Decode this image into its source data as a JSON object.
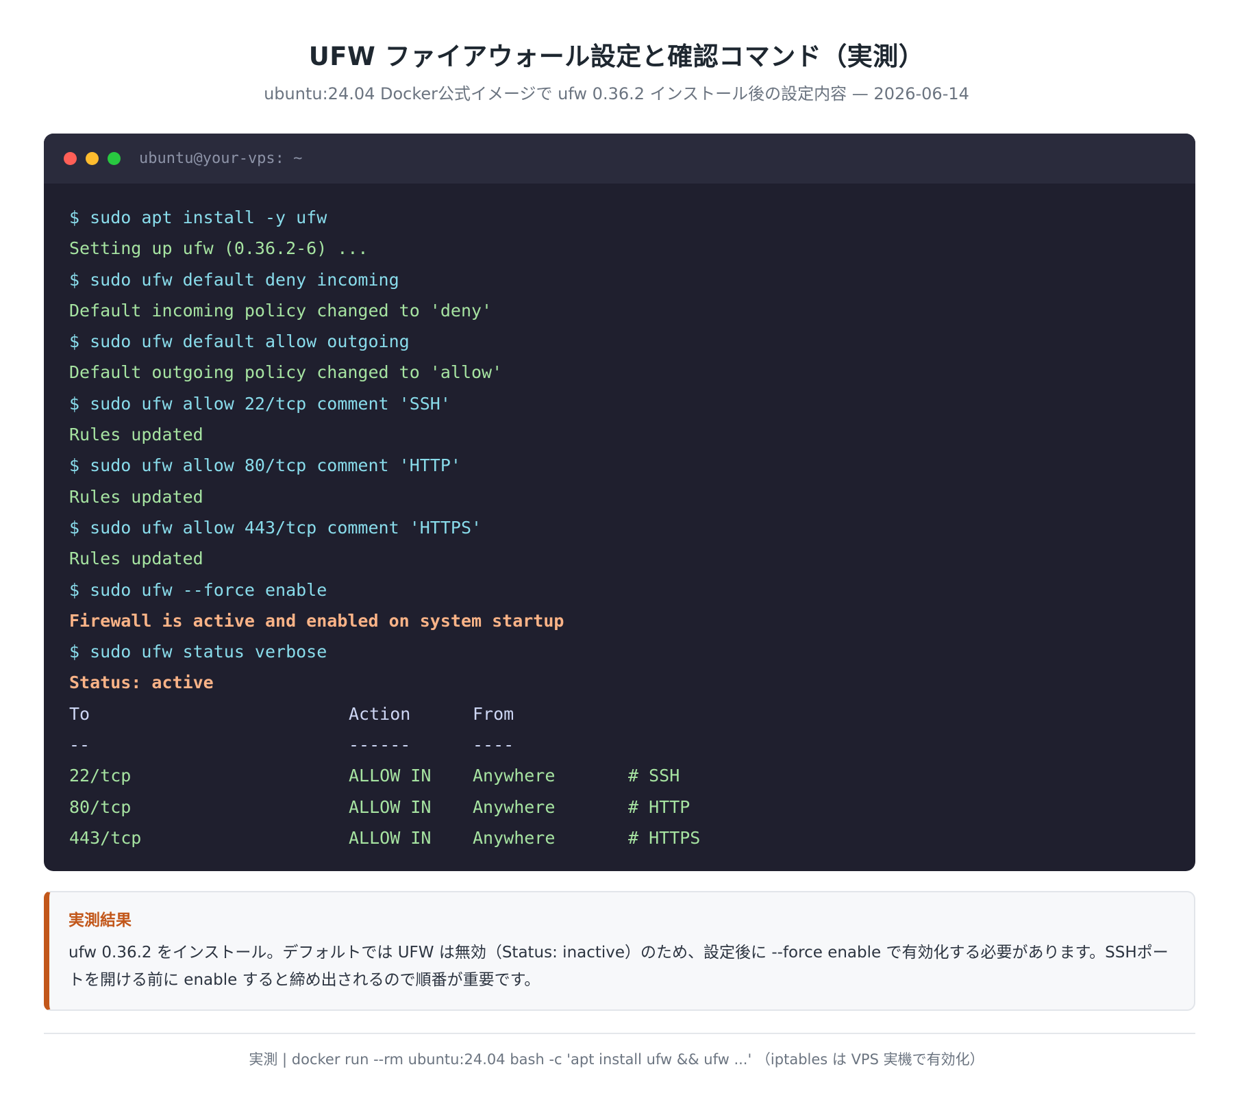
{
  "header": {
    "title": "UFW ファイアウォール設定と確認コマンド（実測）",
    "subtitle": "ubuntu:24.04 Docker公式イメージで ufw 0.36.2 インストール後の設定内容 — 2026-06-14"
  },
  "terminal": {
    "title": "ubuntu@your-vps: ~",
    "lines": [
      {
        "type": "cmd",
        "text": "$ sudo apt install -y ufw"
      },
      {
        "type": "out",
        "text": "Setting up ufw (0.36.2-6) ..."
      },
      {
        "type": "cmd",
        "text": "$ sudo ufw default deny incoming"
      },
      {
        "type": "out",
        "text": "Default incoming policy changed to 'deny'"
      },
      {
        "type": "cmd",
        "text": "$ sudo ufw default allow outgoing"
      },
      {
        "type": "out",
        "text": "Default outgoing policy changed to 'allow'"
      },
      {
        "type": "cmd",
        "text": "$ sudo ufw allow 22/tcp comment 'SSH'"
      },
      {
        "type": "out",
        "text": "Rules updated"
      },
      {
        "type": "cmd",
        "text": "$ sudo ufw allow 80/tcp comment 'HTTP'"
      },
      {
        "type": "out",
        "text": "Rules updated"
      },
      {
        "type": "cmd",
        "text": "$ sudo ufw allow 443/tcp comment 'HTTPS'"
      },
      {
        "type": "out",
        "text": "Rules updated"
      },
      {
        "type": "cmd",
        "text": "$ sudo ufw --force enable"
      },
      {
        "type": "warn",
        "text": "Firewall is active and enabled on system startup"
      },
      {
        "type": "cmd",
        "text": "$ sudo ufw status verbose"
      },
      {
        "type": "warn",
        "text": "Status: active"
      }
    ],
    "table": {
      "headers": {
        "to": "To",
        "action": "Action",
        "from": "From"
      },
      "separators": {
        "to": "--",
        "action": "------",
        "from": "----"
      },
      "rows": [
        {
          "to": "22/tcp",
          "action": "ALLOW IN",
          "from": "Anywhere",
          "comment": "# SSH"
        },
        {
          "to": "80/tcp",
          "action": "ALLOW IN",
          "from": "Anywhere",
          "comment": "# HTTP"
        },
        {
          "to": "443/tcp",
          "action": "ALLOW IN",
          "from": "Anywhere",
          "comment": "# HTTPS"
        }
      ]
    }
  },
  "callout": {
    "title": "実測結果",
    "text": "ufw 0.36.2 をインストール。デフォルトでは UFW は無効（Status: inactive）のため、設定後に --force enable で有効化する必要があります。SSHポートを開ける前に enable すると締め出されるので順番が重要です。"
  },
  "footer": {
    "text": "実測 | docker run --rm ubuntu:24.04 bash -c 'apt install ufw && ufw ...' （iptables は VPS 実機で有効化）"
  },
  "colors": {
    "terminal_bg": "#1f1f2e",
    "command": "#89dceb",
    "output": "#a6e3a1",
    "highlight": "#fab387",
    "accent": "#c2571a"
  }
}
